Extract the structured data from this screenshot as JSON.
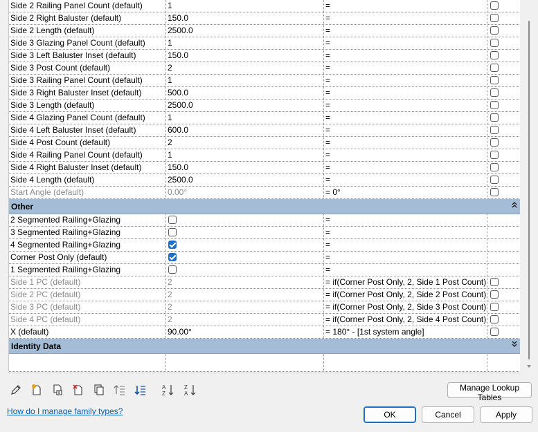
{
  "rows_top": [
    {
      "name": "Side 2 Railing Panel Count (default)",
      "value": "1",
      "formula": "=",
      "muted": false
    },
    {
      "name": "Side 2 Right Baluster (default)",
      "value": "150.0",
      "formula": "=",
      "muted": false
    },
    {
      "name": "Side 2 Length (default)",
      "value": "2500.0",
      "formula": "=",
      "muted": false
    },
    {
      "name": "Side 3 Glazing Panel Count (default)",
      "value": "1",
      "formula": "=",
      "muted": false
    },
    {
      "name": "Side 3 Left Baluster Inset (default)",
      "value": "150.0",
      "formula": "=",
      "muted": false
    },
    {
      "name": "Side 3 Post Count (default)",
      "value": "2",
      "formula": "=",
      "muted": false
    },
    {
      "name": "Side 3 Railing Panel Count (default)",
      "value": "1",
      "formula": "=",
      "muted": false
    },
    {
      "name": "Side 3 Right Baluster Inset (default)",
      "value": "500.0",
      "formula": "=",
      "muted": false
    },
    {
      "name": "Side 3 Length (default)",
      "value": "2500.0",
      "formula": "=",
      "muted": false
    },
    {
      "name": "Side 4 Glazing Panel Count (default)",
      "value": "1",
      "formula": "=",
      "muted": false
    },
    {
      "name": "Side 4 Left Baluster Inset (default)",
      "value": "600.0",
      "formula": "=",
      "muted": false
    },
    {
      "name": "Side 4 Post Count (default)",
      "value": "2",
      "formula": "=",
      "muted": false
    },
    {
      "name": "Side 4 Railing Panel Count (default)",
      "value": "1",
      "formula": "=",
      "muted": false
    },
    {
      "name": "Side 4 Right Baluster Inset (default)",
      "value": "150.0",
      "formula": "=",
      "muted": false
    },
    {
      "name": "Side 4 Length (default)",
      "value": "2500.0",
      "formula": "=",
      "muted": false
    },
    {
      "name": "Start Angle (default)",
      "value": "0.00°",
      "formula": "= 0°",
      "muted": true
    }
  ],
  "group_other": {
    "label": "Other",
    "chevron": "up"
  },
  "rows_other": [
    {
      "name": "2 Segmented Railing+Glazing",
      "value_checkbox": false,
      "formula": "=",
      "muted": false,
      "lock": false
    },
    {
      "name": "3 Segmented Railing+Glazing",
      "value_checkbox": false,
      "formula": "=",
      "muted": false,
      "lock": false
    },
    {
      "name": "4 Segmented Railing+Glazing",
      "value_checkbox": true,
      "formula": "=",
      "muted": false,
      "lock": false
    },
    {
      "name": "Corner Post Only (default)",
      "value_checkbox": true,
      "formula": "=",
      "muted": false,
      "lock": false
    },
    {
      "name": "1 Segmented Railing+Glazing",
      "value_checkbox": false,
      "formula": "=",
      "muted": false,
      "lock": false
    },
    {
      "name": "Side 1 PC (default)",
      "value": "2",
      "formula": "= if(Corner Post Only, 2, Side 1 Post Count)",
      "muted": true,
      "lock": true
    },
    {
      "name": "Side 2 PC (default)",
      "value": "2",
      "formula": "= if(Corner Post Only, 2, Side 2 Post Count)",
      "muted": true,
      "lock": true
    },
    {
      "name": "Side 3 PC (default)",
      "value": "2",
      "formula": "= if(Corner Post Only, 2, Side 3 Post Count)",
      "muted": true,
      "lock": true
    },
    {
      "name": "Side 4 PC (default)",
      "value": "2",
      "formula": "= if(Corner Post Only, 2, Side 4 Post Count)",
      "muted": true,
      "lock": true
    },
    {
      "name": "X (default)",
      "value": "90.00°",
      "formula": "= 180° - [1st system angle]",
      "muted": false,
      "lock": true
    }
  ],
  "group_identity": {
    "label": "Identity Data",
    "chevron": "down"
  },
  "toolbar_icons": [
    "edit-pencil-icon",
    "new-type-icon",
    "duplicate-type-icon",
    "delete-type-icon",
    "copy-icon",
    "move-up-icon",
    "move-down-icon",
    "sort-ascending-icon",
    "sort-descending-icon"
  ],
  "buttons": {
    "manage_lookup": "Manage Lookup Tables",
    "ok": "OK",
    "cancel": "Cancel",
    "apply": "Apply"
  },
  "help_link": "How do I manage family types?",
  "colors": {
    "group_header": "#a4bcd6",
    "checkbox_checked": "#1f6fc5",
    "link": "#0b5cad"
  }
}
